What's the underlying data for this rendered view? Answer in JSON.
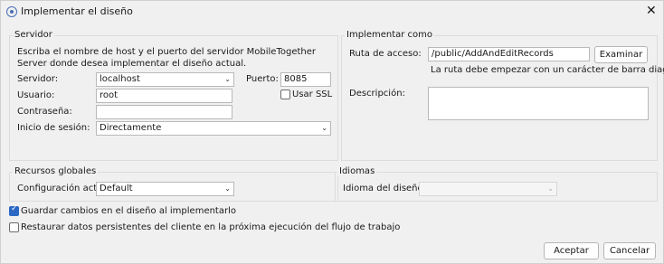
{
  "window": {
    "title": "Implementar el diseño",
    "close_glyph": "✕"
  },
  "servidor": {
    "group_label": "Servidor",
    "description": "Escriba el nombre de host y el puerto del servidor MobileTogether Server donde desea implementar el diseño actual.",
    "server_label": "Servidor:",
    "server_value": "localhost",
    "port_label": "Puerto:",
    "port_value": "8085",
    "user_label": "Usuario:",
    "user_value": "root",
    "ssl_label": "Usar SSL",
    "password_label": "Contraseña:",
    "password_value": "",
    "login_label": "Inicio de sesión:",
    "login_value": "Directamente"
  },
  "implementar": {
    "group_label": "Implementar como",
    "path_label": "Ruta de acceso:",
    "path_value": "/public/AddAndEditRecords",
    "browse_label": "Examinar",
    "hint": "La ruta debe empezar con un carácter de barra diagonal.",
    "description_label": "Descripción:",
    "description_value": ""
  },
  "recursos": {
    "group_label": "Recursos globales",
    "config_label": "Configuración activa:",
    "config_value": "Default"
  },
  "idiomas": {
    "group_label": "Idiomas",
    "lang_label": "Idioma del diseño:",
    "lang_value": ""
  },
  "options": {
    "save_changes_label": "Guardar cambios en el diseño al implementarlo",
    "save_changes_checked": true,
    "restore_label": "Restaurar datos persistentes del cliente en la próxima ejecución del flujo de trabajo",
    "restore_checked": false
  },
  "buttons": {
    "accept": "Aceptar",
    "cancel": "Cancelar"
  },
  "icons": {
    "dropdown": "chevron-down-icon",
    "app": "app-logo-icon"
  }
}
